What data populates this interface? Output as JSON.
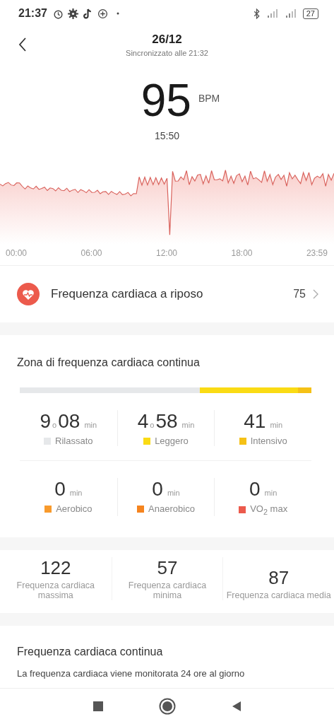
{
  "status_bar": {
    "time": "21:37",
    "battery": "27"
  },
  "header": {
    "title": "26/12",
    "subtitle": "Sincronizzato alle 21:32"
  },
  "current": {
    "value": "95",
    "unit": "BPM",
    "time": "15:50"
  },
  "chart": {
    "x_labels": [
      "00:00",
      "06:00",
      "12:00",
      "18:00",
      "23:59"
    ]
  },
  "resting": {
    "label": "Frequenza cardiaca a riposo",
    "value": "75"
  },
  "zones": {
    "title": "Zona di frequenza cardiaca continua",
    "items": [
      {
        "hours": "9",
        "hours_unit": "o",
        "minutes": "08",
        "unit": "min",
        "label": "Rilassato",
        "color": "#e6e8ea"
      },
      {
        "hours": "4",
        "hours_unit": "o",
        "minutes": "58",
        "unit": "min",
        "label": "Leggero",
        "color": "#fadb14"
      },
      {
        "minutes": "41",
        "unit": "min",
        "label": "Intensivo",
        "color": "#f5c116"
      },
      {
        "minutes": "0",
        "unit": "min",
        "label": "Aerobico",
        "color": "#f89a2c"
      },
      {
        "minutes": "0",
        "unit": "min",
        "label": "Anaerobico",
        "color": "#f5841f"
      },
      {
        "minutes": "0",
        "unit": "min",
        "label": "VO$_{2}$ max",
        "color": "#ec5a4c"
      }
    ]
  },
  "stats": [
    {
      "value": "122",
      "label": "Frequenza cardiaca massima"
    },
    {
      "value": "57",
      "label": "Frequenza cardiaca minima"
    },
    {
      "value": "87",
      "label": "Frequenza cardiaca media"
    }
  ],
  "info": {
    "title": "Frequenza cardiaca continua",
    "text": "La frequenza cardiaca viene monitorata 24 ore al giorno"
  }
}
